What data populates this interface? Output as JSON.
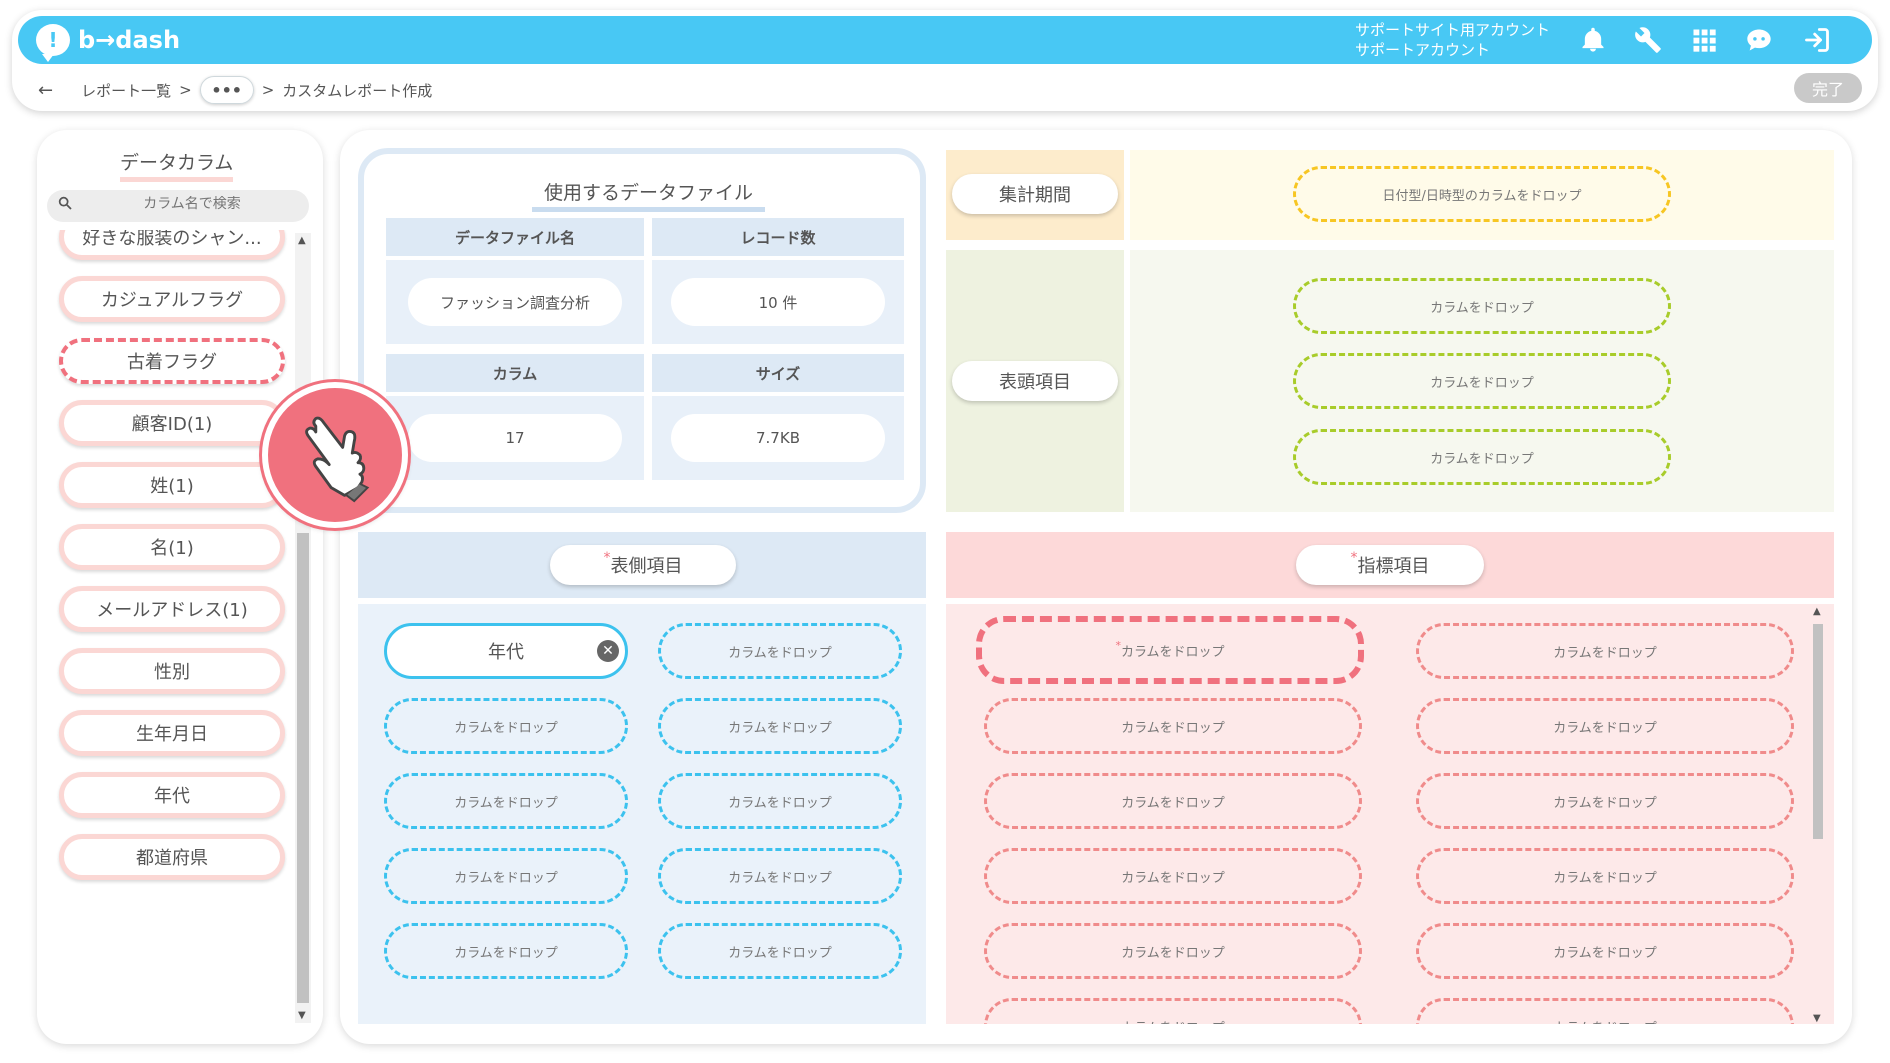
{
  "header": {
    "brand": "b→dash",
    "account_line1": "サポートサイト用アカウント",
    "account_line2": "サポートアカウント",
    "icons": [
      "bell-icon",
      "wrench-icon",
      "grid-icon",
      "chat-bot-icon",
      "logout-icon"
    ]
  },
  "breadcrumb": {
    "back": "←",
    "item1": "レポート一覧",
    "sep": ">",
    "more": "•••",
    "current": "カスタムレポート作成"
  },
  "done_label": "完了",
  "left": {
    "title": "データカラム",
    "search_placeholder": "カラム名で検索",
    "items": [
      "好きな服装のシャン...",
      "カジュアルフラグ",
      "古着フラグ",
      "顧客ID(1)",
      "姓(1)",
      "名(1)",
      "メールアドレス(1)",
      "性別",
      "生年月日",
      "年代",
      "都道府県"
    ]
  },
  "datafile": {
    "title": "使用するデータファイル",
    "name_header": "データファイル名",
    "name_value": "ファッション調査分析",
    "records_header": "レコード数",
    "records_value": "10 件",
    "columns_header": "カラム",
    "columns_value": "17",
    "size_header": "サイズ",
    "size_value": "7.7KB"
  },
  "period": {
    "label": "集計期間",
    "drop": "日付型/日時型のカラムをドロップ"
  },
  "header_items": {
    "label": "表頭項目",
    "drop": "カラムをドロップ"
  },
  "row_items": {
    "required": "*",
    "label": "表側項目",
    "filled": "年代",
    "drop": "カラムをドロップ"
  },
  "metric_items": {
    "required": "*",
    "label": "指標項目",
    "drop": "カラムをドロップ"
  }
}
